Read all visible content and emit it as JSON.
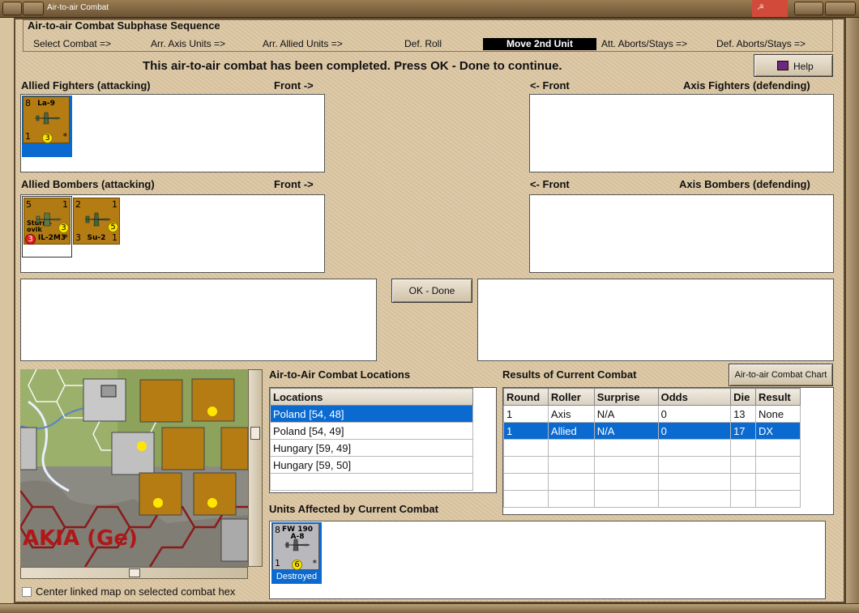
{
  "window": {
    "title": "Air-to-air Combat"
  },
  "sequence": {
    "title": "Air-to-air Combat Subphase Sequence",
    "steps": [
      "Select Combat =>",
      "Arr. Axis Units =>",
      "Arr. Allied Units =>",
      "Def. Roll",
      "Move 2nd Unit",
      "Att. Aborts/Stays =>",
      "Def. Aborts/Stays =>"
    ],
    "active_step": "Move 2nd Unit"
  },
  "status_message": "This air-to-air combat has been completed.  Press OK - Done to continue.",
  "help_button": "Help",
  "sections": {
    "allied_fighters": "Allied Fighters (attacking)",
    "axis_fighters": "Axis Fighters (defending)",
    "allied_bombers": "Allied Bombers (attacking)",
    "axis_bombers": "Axis Bombers (defending)",
    "front_right": "Front ->",
    "front_left": "<- Front"
  },
  "allied_fighters": [
    {
      "name": "La-9",
      "tl": "8",
      "bl": "1",
      "br": "*",
      "dot": "3"
    }
  ],
  "allied_bombers": [
    {
      "name": "IL-2M3",
      "sub": "Sturm-ovik",
      "tl": "5",
      "tr": "1",
      "bl": "3",
      "br": "*",
      "dot": "3",
      "red": "3"
    },
    {
      "name": "Su-2",
      "tl": "2",
      "tr": "1",
      "bl": "3",
      "br": "1",
      "dot": "5"
    }
  ],
  "ok_button": "OK - Done",
  "map_label": "AKIA (Ge)",
  "center_map_checkbox": "Center linked map on selected combat hex",
  "locations": {
    "title": "Air-to-Air Combat Locations",
    "header": "Locations",
    "rows": [
      "Poland [54, 48]",
      "Poland [54, 49]",
      "Hungary [59, 49]",
      "Hungary [59, 50]"
    ],
    "selected_index": 0
  },
  "results": {
    "title": "Results of Current Combat",
    "chart_button": "Air-to-air Combat Chart",
    "headers": [
      "Round",
      "Roller",
      "Surprise",
      "Odds",
      "Die",
      "Result"
    ],
    "rows": [
      [
        "1",
        "Axis",
        "N/A",
        "0",
        "13",
        "None"
      ],
      [
        "1",
        "Allied",
        "N/A",
        "0",
        "17",
        "DX"
      ]
    ],
    "selected_index": 1
  },
  "affected": {
    "title": "Units Affected by Current Combat",
    "units": [
      {
        "name": "FW 190 A-8",
        "tl": "8",
        "bl": "1",
        "br": "*",
        "dot": "6",
        "status": "Destroyed"
      }
    ]
  },
  "colors": {
    "accent": "#0a6ad0",
    "counter_allied": "#b47c12",
    "selected_step": "#000000"
  }
}
